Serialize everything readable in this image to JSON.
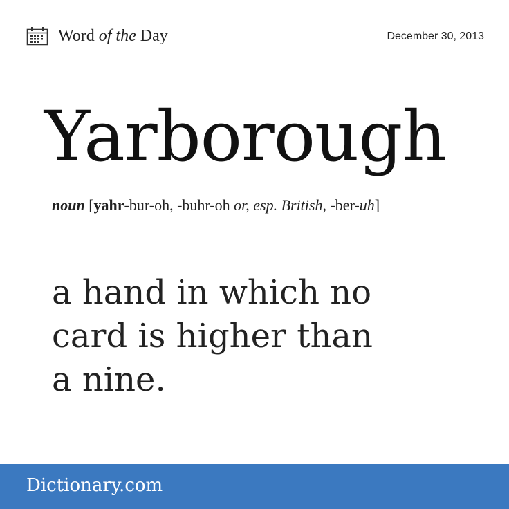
{
  "header": {
    "icon": "calendar-icon",
    "title_part1": "Word ",
    "title_emphasis": "of the",
    "title_part2": " Day",
    "date": "December 30, 2013"
  },
  "entry": {
    "word": "Yarborough",
    "part_of_speech": "noun",
    "pron_open": " [",
    "pron_stress": "yahr",
    "pron_rest1": "-bur-oh, -buhr-oh ",
    "pron_italic": "or, esp. British,",
    "pron_rest2": " -ber-",
    "pron_italic2": "uh",
    "pron_close": "]",
    "definition_lines": [
      "a hand in which no",
      "card is higher than",
      "a nine."
    ]
  },
  "footer": {
    "brand": "Dictionary.com"
  },
  "colors": {
    "footer_bg": "#3b79c0",
    "text": "#111111"
  }
}
